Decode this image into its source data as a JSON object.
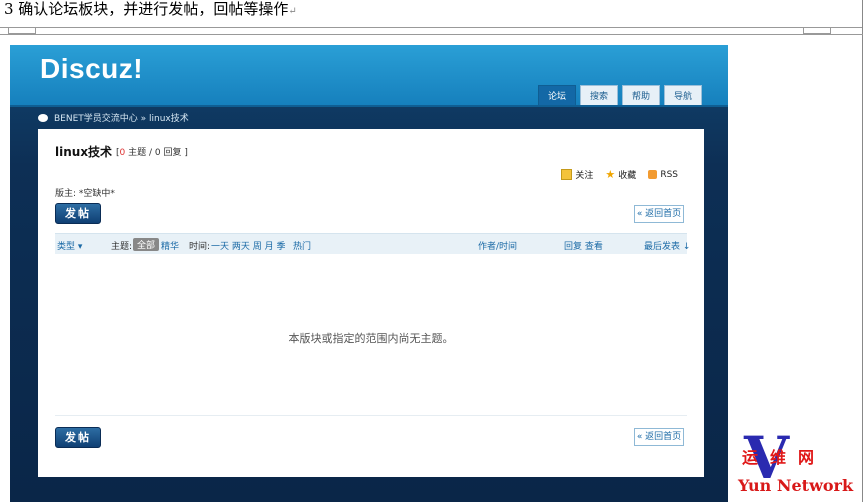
{
  "document": {
    "caption": "3 确认论坛板块，并进行发帖，回帖等操作",
    "return_mark": "↵"
  },
  "site": {
    "logo": "Discuz!",
    "tabs": [
      {
        "label": "论坛",
        "active": true
      },
      {
        "label": "搜索",
        "active": false
      },
      {
        "label": "帮助",
        "active": false
      },
      {
        "label": "导航",
        "active": false
      }
    ],
    "breadcrumb": "BENET学员交流中心 » linux技术"
  },
  "forum": {
    "title": "linux技术",
    "stats_prefix": "[",
    "threads_count": "0",
    "stats_rest": " 主题 / 0 回复 ]",
    "moderator": "版主: *空缺中*",
    "tools": {
      "follow": "关注",
      "favorite": "收藏",
      "rss": "RSS"
    },
    "post_button": "发帖",
    "back_button": "« 返回首页",
    "list_header": {
      "type": "类型 ▾",
      "topic_label": "主题:",
      "all": "全部",
      "digest": "精华",
      "time_label": "时间:",
      "time_filters": "一天  两天  周  月  季",
      "hot": "热门",
      "author_time": "作者/时间",
      "reply_view": "回复 查看",
      "last_post": "最后发表 ↓"
    },
    "empty_message": "本版块或指定的范围内尚无主题。"
  },
  "watermark": {
    "letter": "V",
    "chinese": "运维网",
    "english": "Yun  Network"
  },
  "colors": {
    "header": "#1f8fcb",
    "background": "#0d2f55",
    "accent_link": "#1b6aa6",
    "watermark_red": "#e01818",
    "watermark_blue": "#2a2ab0"
  }
}
